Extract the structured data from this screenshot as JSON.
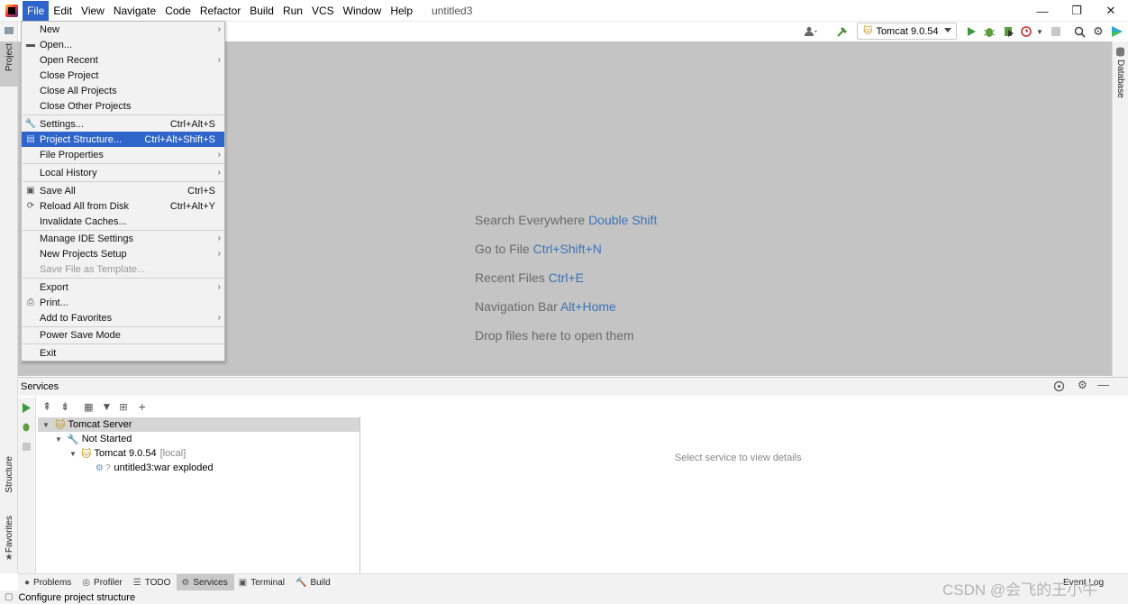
{
  "menubar": {
    "items": [
      "File",
      "Edit",
      "View",
      "Navigate",
      "Code",
      "Refactor",
      "Build",
      "Run",
      "VCS",
      "Window",
      "Help"
    ],
    "project_title": "untitled3"
  },
  "window_controls": {
    "minimize": "—",
    "maximize": "❐",
    "close": "✕"
  },
  "toolbar": {
    "run_config": "Tomcat 9.0.54"
  },
  "file_menu": {
    "new": "New",
    "open": "Open...",
    "open_recent": "Open Recent",
    "close_project": "Close Project",
    "close_all_projects": "Close All Projects",
    "close_other_projects": "Close Other Projects",
    "settings": "Settings...",
    "settings_shortcut": "Ctrl+Alt+S",
    "project_structure": "Project Structure...",
    "project_structure_shortcut": "Ctrl+Alt+Shift+S",
    "file_properties": "File Properties",
    "local_history": "Local History",
    "save_all": "Save All",
    "save_all_shortcut": "Ctrl+S",
    "reload_all": "Reload All from Disk",
    "reload_all_shortcut": "Ctrl+Alt+Y",
    "invalidate_caches": "Invalidate Caches...",
    "manage_ide_settings": "Manage IDE Settings",
    "new_projects_setup": "New Projects Setup",
    "save_as_template": "Save File as Template...",
    "export": "Export",
    "print": "Print...",
    "add_to_favorites": "Add to Favorites",
    "power_save_mode": "Power Save Mode",
    "exit": "Exit"
  },
  "editor_hints": [
    {
      "label": "Search Everywhere",
      "shortcut": "Double Shift"
    },
    {
      "label": "Go to File",
      "shortcut": "Ctrl+Shift+N"
    },
    {
      "label": "Recent Files",
      "shortcut": "Ctrl+E"
    },
    {
      "label": "Navigation Bar",
      "shortcut": "Alt+Home"
    },
    {
      "label": "Drop files here to open them",
      "shortcut": ""
    }
  ],
  "left_strip": {
    "project": "Project",
    "structure": "Structure",
    "favorites": "Favorites"
  },
  "right_strip": {
    "database": "Database"
  },
  "services": {
    "title": "Services",
    "tree": {
      "tomcat_server": "Tomcat Server",
      "not_started": "Not Started",
      "tomcat_instance": "Tomcat 9.0.54",
      "tomcat_instance_tag": "[local]",
      "artifact": "untitled3:war exploded"
    },
    "detail_placeholder": "Select service to view details"
  },
  "bottom_tabs": [
    "Problems",
    "Profiler",
    "TODO",
    "Services",
    "Terminal",
    "Build"
  ],
  "event_log": "Event Log",
  "statusbar": {
    "message": "Configure project structure"
  },
  "watermark": "CSDN @会飞的王小牛"
}
